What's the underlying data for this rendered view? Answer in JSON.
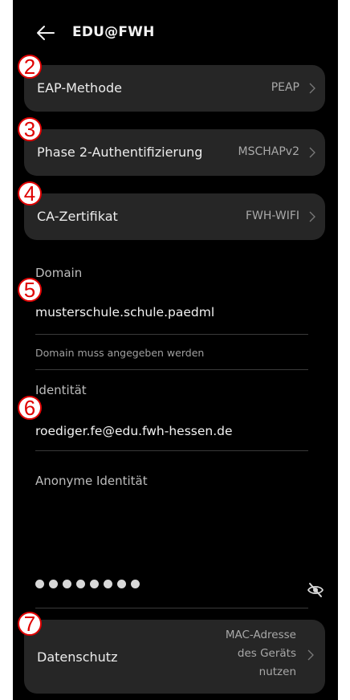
{
  "header": {
    "title": "EDU@FWH",
    "back_icon": "back-arrow-icon"
  },
  "cards": {
    "eap": {
      "label": "EAP-Methode",
      "value": "PEAP"
    },
    "phase2": {
      "label": "Phase 2-Authentifizierung",
      "value": "MSCHAPv2"
    },
    "ca": {
      "label": "CA-Zertifikat",
      "value": "FWH-WIFI"
    }
  },
  "domain": {
    "label": "Domain",
    "value": "musterschule.schule.paedml",
    "hint": "Domain muss angegeben werden"
  },
  "identity": {
    "label": "Identität",
    "value": "roediger.fe@edu.fwh-hessen.de"
  },
  "anonymous_identity": {
    "label": "Anonyme Identität"
  },
  "password": {
    "masked_length": 8,
    "toggle_icon": "eye-off-icon"
  },
  "privacy": {
    "label": "Datenschutz",
    "value_lines": [
      "MAC-Adresse",
      "des Geräts",
      "nutzen"
    ]
  },
  "badges": {
    "b2": "2",
    "b3": "3",
    "b4": "4",
    "b5": "5",
    "b6": "6",
    "b7": "7"
  },
  "colors": {
    "background": "#000000",
    "card": "#262626",
    "badge_red": "#e00000"
  }
}
